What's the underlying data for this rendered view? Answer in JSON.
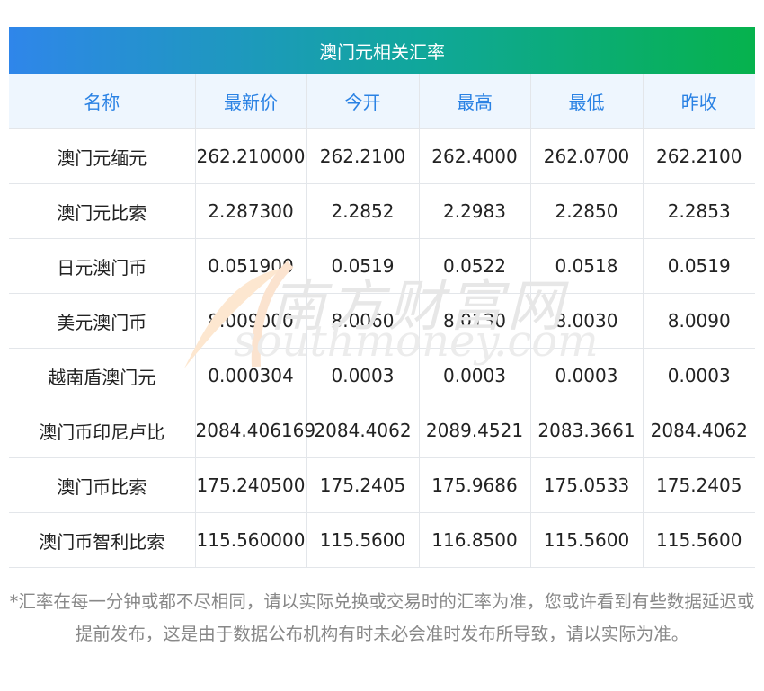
{
  "title": "澳门元相关汇率",
  "headers": [
    "名称",
    "最新价",
    "今开",
    "最高",
    "最低",
    "昨收"
  ],
  "rows": [
    [
      "澳门元缅元",
      "262.210000",
      "262.2100",
      "262.4000",
      "262.0700",
      "262.2100"
    ],
    [
      "澳门元比索",
      "2.287300",
      "2.2852",
      "2.2983",
      "2.2850",
      "2.2853"
    ],
    [
      "日元澳门币",
      "0.051900",
      "0.0519",
      "0.0522",
      "0.0518",
      "0.0519"
    ],
    [
      "美元澳门币",
      "8.009000",
      "8.0060",
      "8.0130",
      "8.0030",
      "8.0090"
    ],
    [
      "越南盾澳门元",
      "0.000304",
      "0.0003",
      "0.0003",
      "0.0003",
      "0.0003"
    ],
    [
      "澳门币印尼卢比",
      "2084.406169",
      "2084.4062",
      "2089.4521",
      "2083.3661",
      "2084.4062"
    ],
    [
      "澳门币比索",
      "175.240500",
      "175.2405",
      "175.9686",
      "175.0533",
      "175.2405"
    ],
    [
      "澳门币智利比索",
      "115.560000",
      "115.5600",
      "116.8500",
      "115.5600",
      "115.5600"
    ]
  ],
  "watermark": {
    "cn": "南方财富网",
    "en": "southmoney.com"
  },
  "footnote": "*汇率在每一分钟或都不尽相同，请以实际兑换或交易时的汇率为准，您或许看到有些数据延迟或提前发布，这是由于数据公布机构有时未必会准时发布所导致，请以实际为准。",
  "colors": {
    "banner_start": "#2f86ea",
    "banner_end": "#06b24d",
    "header_bg": "#eef6fe",
    "header_text": "#2a82e4",
    "footnote_text": "#888888"
  }
}
